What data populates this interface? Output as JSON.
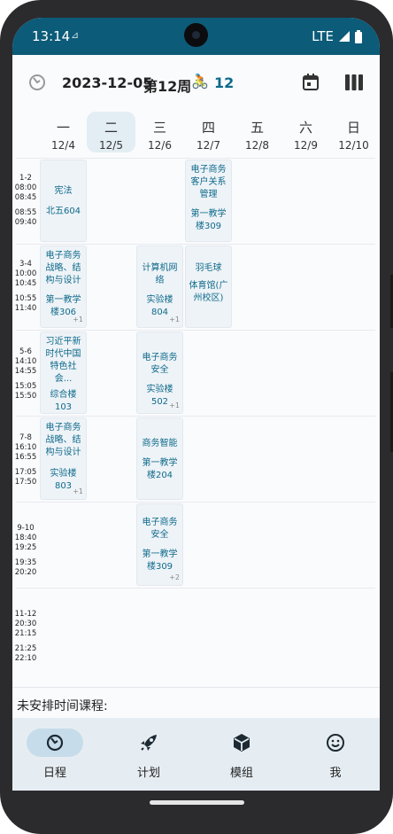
{
  "status": {
    "time": "13:14",
    "network": "LTE"
  },
  "header": {
    "date": "2023-12-05",
    "week": "第12周",
    "bike": "🚴",
    "week_num": "12"
  },
  "days": [
    {
      "weekday": "一",
      "date": "12/4"
    },
    {
      "weekday": "二",
      "date": "12/5"
    },
    {
      "weekday": "三",
      "date": "12/6"
    },
    {
      "weekday": "四",
      "date": "12/7"
    },
    {
      "weekday": "五",
      "date": "12/8"
    },
    {
      "weekday": "六",
      "date": "12/9"
    },
    {
      "weekday": "日",
      "date": "12/10"
    }
  ],
  "slots": [
    {
      "num": "1-2",
      "t1": "08:00",
      "t2": "08:45",
      "t3": "08:55",
      "t4": "09:40"
    },
    {
      "num": "3-4",
      "t1": "10:00",
      "t2": "10:45",
      "t3": "10:55",
      "t4": "11:40"
    },
    {
      "num": "5-6",
      "t1": "14:10",
      "t2": "14:55",
      "t3": "15:05",
      "t4": "15:50"
    },
    {
      "num": "7-8",
      "t1": "16:10",
      "t2": "16:55",
      "t3": "17:05",
      "t4": "17:50"
    },
    {
      "num": "9-10",
      "t1": "18:40",
      "t2": "19:25",
      "t3": "19:35",
      "t4": "20:20"
    },
    {
      "num": "11-12",
      "t1": "20:30",
      "t2": "21:15",
      "t3": "21:25",
      "t4": "22:10"
    }
  ],
  "courses": [
    {
      "name": "宪法",
      "room": "北五604",
      "more": ""
    },
    {
      "name": "电子商务战略、结构与设计",
      "room": "第一教学楼306",
      "more": "+1"
    },
    {
      "name": "习近平新时代中国特色社会...",
      "room": "综合楼103",
      "more": ""
    },
    {
      "name": "电子商务战略、结构与设计",
      "room": "实验楼803",
      "more": "+1"
    },
    {
      "name": "计算机网络",
      "room": "实验楼804",
      "more": "+1"
    },
    {
      "name": "电子商务安全",
      "room": "实验楼502",
      "more": "+1"
    },
    {
      "name": "商务智能",
      "room": "第一教学楼204",
      "more": ""
    },
    {
      "name": "电子商务安全",
      "room": "第一教学楼309",
      "more": "+2"
    },
    {
      "name": "电子商务客户关系管理",
      "room": "第一教学楼309",
      "more": ""
    },
    {
      "name": "羽毛球",
      "room": "体育馆(广州校区)",
      "more": ""
    }
  ],
  "unscheduled_label": "未安排时间课程:",
  "nav": [
    {
      "label": "日程"
    },
    {
      "label": "计划"
    },
    {
      "label": "模组"
    },
    {
      "label": "我"
    }
  ],
  "colors": {
    "status_bar": "#0c5b79",
    "accent": "#0e6a8b",
    "nav_bg": "#e6edf2",
    "nav_active": "#c6dcea"
  }
}
